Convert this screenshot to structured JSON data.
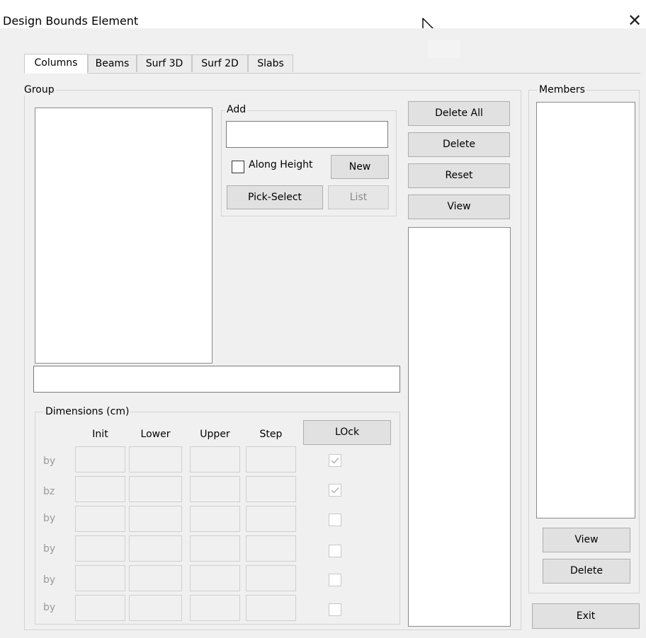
{
  "window": {
    "title": "Design Bounds Element",
    "close_icon": "close-icon"
  },
  "tabs": [
    {
      "label": "Columns",
      "active": true
    },
    {
      "label": "Beams",
      "active": false
    },
    {
      "label": "Surf 3D",
      "active": false
    },
    {
      "label": "Surf 2D",
      "active": false
    },
    {
      "label": "Slabs",
      "active": false
    }
  ],
  "group": {
    "label": "Group",
    "name_input_value": ""
  },
  "add": {
    "label": "Add",
    "input_value": "",
    "along_height_label": "Along Height",
    "along_height_checked": false,
    "new_label": "New",
    "pick_select_label": "Pick-Select",
    "list_label": "List"
  },
  "middle_buttons": {
    "delete_all": "Delete All",
    "delete": "Delete",
    "reset": "Reset",
    "view": "View"
  },
  "members": {
    "label": "Members",
    "view_label": "View",
    "delete_label": "Delete"
  },
  "exit_label": "Exit",
  "dimensions": {
    "label": "Dimensions (cm)",
    "headers": {
      "init": "Init",
      "lower": "Lower",
      "upper": "Upper",
      "step": "Step"
    },
    "lock_label": "LOck",
    "rows": [
      {
        "label": "by",
        "locked": true
      },
      {
        "label": "bz",
        "locked": true
      },
      {
        "label": "by",
        "locked": false
      },
      {
        "label": "by",
        "locked": false
      },
      {
        "label": "by",
        "locked": false
      },
      {
        "label": "by",
        "locked": false
      }
    ]
  }
}
